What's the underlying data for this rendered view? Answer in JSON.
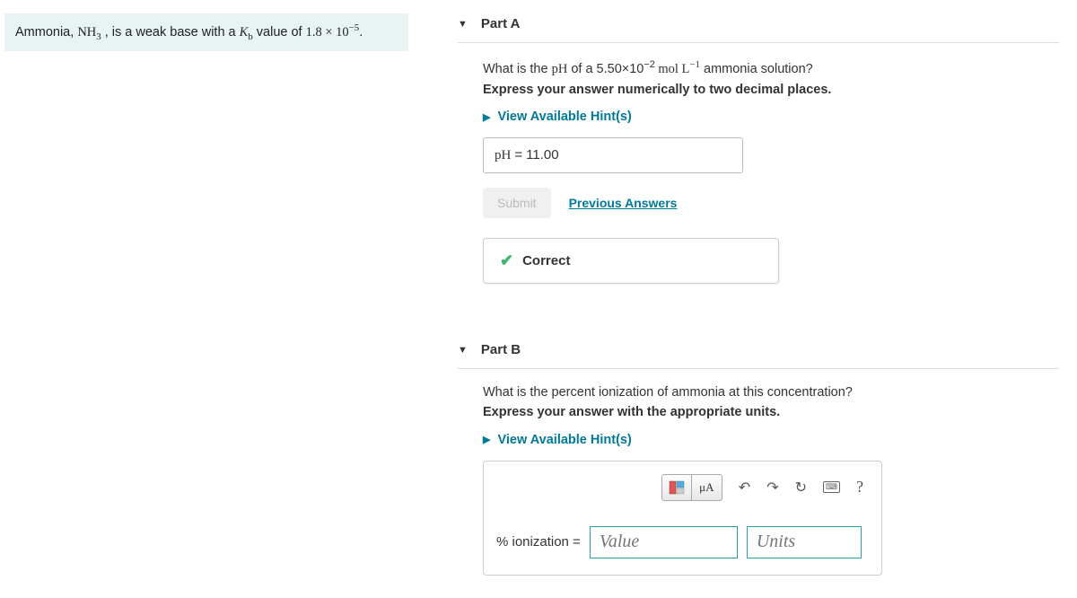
{
  "info": {
    "pre": "Ammonia, ",
    "formula_base": "NH",
    "formula_sub": "3",
    "mid": " , is a weak base with a ",
    "kb_base": "K",
    "kb_sub": "b",
    "mid2": " value of ",
    "val_base": "1.8 × 10",
    "val_sup": "−5",
    "end": "."
  },
  "partA": {
    "title": "Part A",
    "q_pre": "What is the ",
    "q_pH": "pH",
    "q_mid": " of a 5.50×10",
    "q_sup1": "−2",
    "q_mid2": " mol L",
    "q_sup2": "−1",
    "q_end": " ammonia solution?",
    "instr": "Express your answer numerically to two decimal places.",
    "hints": "View Available Hint(s)",
    "answer_label": "pH",
    "answer_eq": " = ",
    "answer_val": "11.00",
    "submit": "Submit",
    "prev": "Previous Answers",
    "correct": "Correct"
  },
  "partB": {
    "title": "Part B",
    "q": "What is the percent ionization of ammonia at this concentration?",
    "instr": "Express your answer with the appropriate units.",
    "hints": "View Available Hint(s)",
    "toolbar": {
      "mu": "μA",
      "help": "?"
    },
    "label": "% ionization =",
    "value_ph": "Value",
    "units_ph": "Units"
  }
}
